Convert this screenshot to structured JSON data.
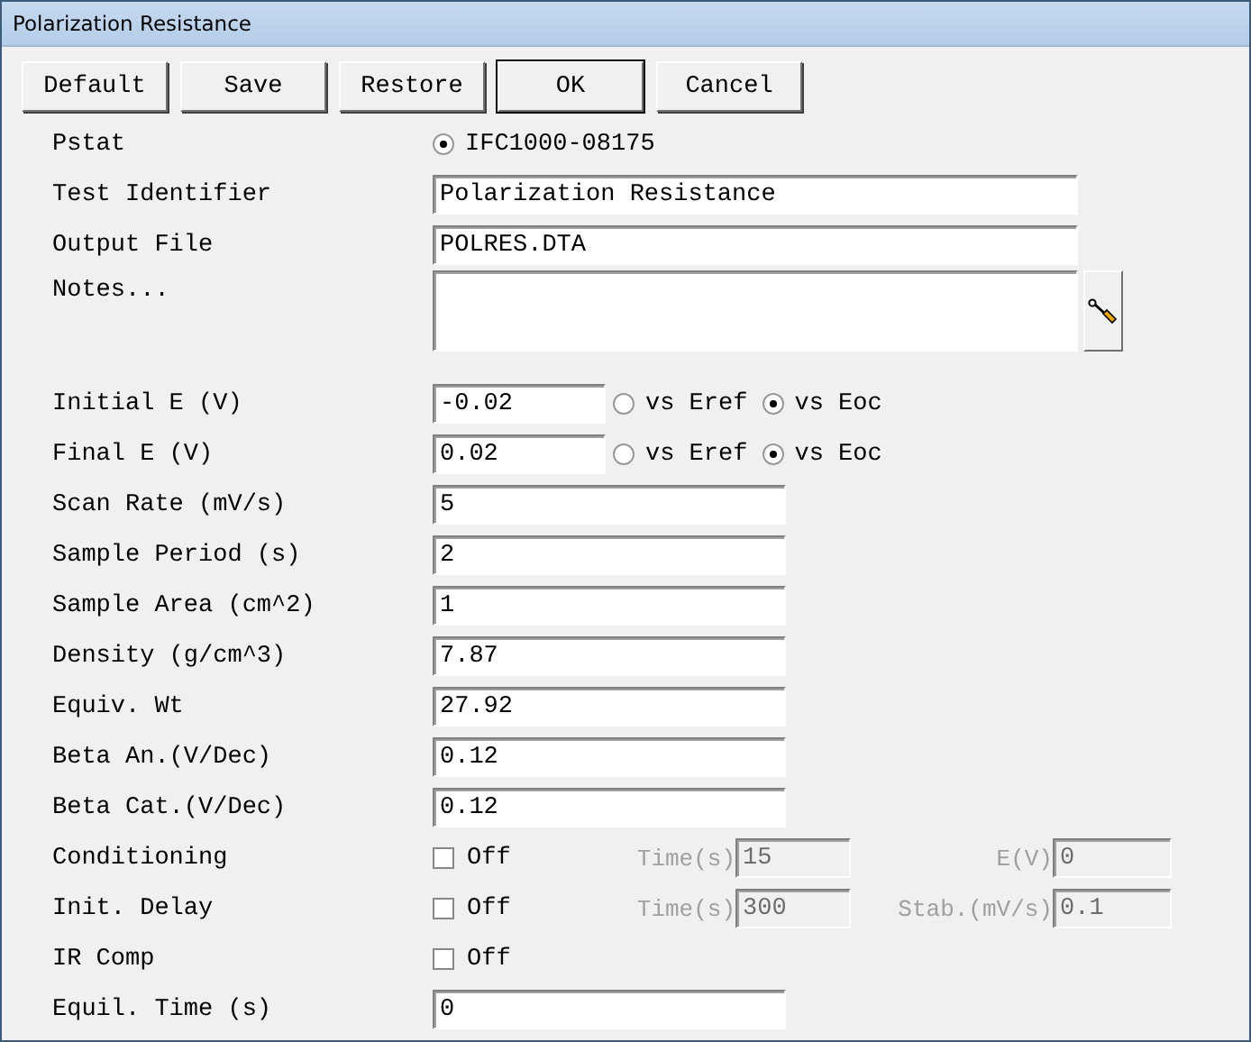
{
  "window": {
    "title": "Polarization Resistance"
  },
  "buttons": [
    {
      "label": "Default",
      "default": false
    },
    {
      "label": "Save",
      "default": false
    },
    {
      "label": "Restore",
      "default": false
    },
    {
      "label": "OK",
      "default": true
    },
    {
      "label": "Cancel",
      "default": false
    }
  ],
  "rows": [
    {
      "kind": "radio",
      "label": "Pstat",
      "option": "IFC1000-08175",
      "selected": true
    },
    {
      "kind": "text",
      "label": "Test Identifier",
      "value": "Polarization Resistance"
    },
    {
      "kind": "text",
      "label": "Output File",
      "value": "POLRES.DTA"
    },
    {
      "kind": "notes",
      "label": "Notes..."
    },
    {
      "kind": "potential",
      "label": "Initial E (V)",
      "value": "-0.02",
      "options": [
        {
          "label": "vs Eref",
          "selected": false
        },
        {
          "label": "vs Eoc",
          "selected": true
        }
      ]
    },
    {
      "kind": "potential",
      "label": "Final E (V)",
      "value": "0.02",
      "options": [
        {
          "label": "vs Eref",
          "selected": false
        },
        {
          "label": "vs Eoc",
          "selected": true
        }
      ]
    },
    {
      "kind": "number",
      "label": "Scan Rate (mV/s)",
      "value": "5"
    },
    {
      "kind": "number",
      "label": "Sample Period (s)",
      "value": "2"
    },
    {
      "kind": "number",
      "label": "Sample Area (cm^2)",
      "value": "1"
    },
    {
      "kind": "number",
      "label": "Density (g/cm^3)",
      "value": "7.87"
    },
    {
      "kind": "number",
      "label": "Equiv. Wt",
      "value": "27.92"
    },
    {
      "kind": "number",
      "label": "Beta An.(V/Dec)",
      "value": "0.12"
    },
    {
      "kind": "number",
      "label": "Beta Cat.(V/Dec)",
      "value": "0.12"
    },
    {
      "kind": "check",
      "label": "Conditioning",
      "check_label": "Off",
      "checked": false,
      "params": [
        {
          "label": "Time(s)",
          "value": "15",
          "disabled": true
        },
        {
          "label": "E(V)",
          "value": "0",
          "disabled": true
        }
      ]
    },
    {
      "kind": "check",
      "label": "Init. Delay",
      "check_label": "Off",
      "checked": false,
      "params": [
        {
          "label": "Time(s)",
          "value": "300",
          "disabled": true
        },
        {
          "label": "Stab.(mV/s)",
          "value": "0.1",
          "disabled": true
        }
      ]
    },
    {
      "kind": "check",
      "label": "IR Comp",
      "check_label": "Off",
      "checked": false
    },
    {
      "kind": "number",
      "label": "Equil. Time (s)",
      "value": "0"
    }
  ]
}
